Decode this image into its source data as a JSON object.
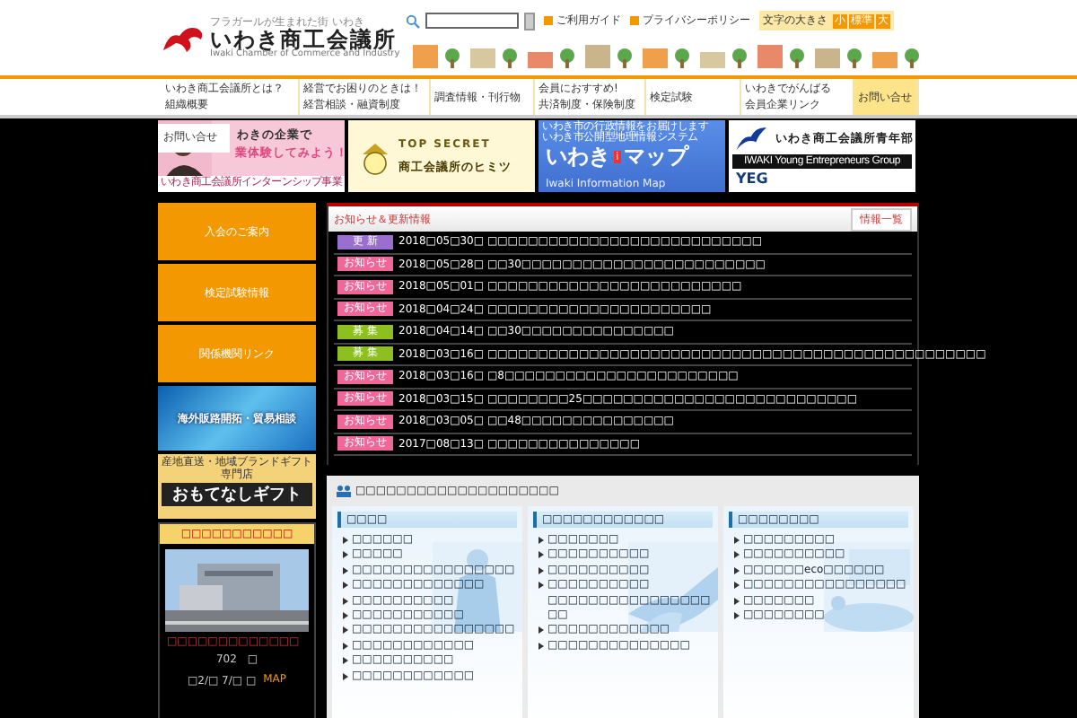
{
  "header": {
    "tagline": "フラガールが生まれた街 いわき",
    "logo_title": "いわき商工会議所",
    "logo_subtitle": "Iwaki Chamber of Commerce and Industry",
    "links": [
      "ご利用ガイド",
      "プライバシーポリシー"
    ],
    "font_size": {
      "label": "文字の大きさ",
      "options": [
        "小",
        "標準",
        "大"
      ]
    }
  },
  "nav": [
    {
      "lines": [
        "いわき商工会議所とは？",
        "組織概要"
      ],
      "selected": false
    },
    {
      "lines": [
        "経営でお困りのときは！",
        "経営相談・融資制度"
      ],
      "selected": false
    },
    {
      "lines": [
        "調査情報・刊行物"
      ],
      "selected": false
    },
    {
      "lines": [
        "会員におすすめ!",
        "共済制度・保険制度"
      ],
      "selected": false
    },
    {
      "lines": [
        "検定試験"
      ],
      "selected": false
    },
    {
      "lines": [
        "いわきでがんばる",
        "会員企業リンク"
      ],
      "selected": false
    },
    {
      "lines": [
        "お問い合せ"
      ],
      "selected": true
    }
  ],
  "tooltip": "お問い合せ",
  "banners": {
    "internship": {
      "line1": "わきの企業で",
      "line2": "業体験してみよう！",
      "footer": "いわき商工会議所インターンシップ事業"
    },
    "secret": {
      "line1": "TOP SECRET",
      "line2": "商工会議所のヒミツ"
    },
    "map": {
      "line1": "いわき市の行政情報をお届けします",
      "line2": "いわき市公開型地理情報システム",
      "word1": "いわき",
      "mark": "i",
      "word2": "マップ",
      "footer": "Iwaki Information Map"
    },
    "yeg": {
      "logo": "YEG",
      "title": "いわき商工会議所青年部",
      "subtitle": "IWAKI Young Entrepreneurs Group"
    }
  },
  "sidebar": {
    "buttons": [
      "入会のご案内",
      "検定試験情報",
      "関係機関リンク"
    ],
    "overseas_banner": "海外販路開拓・貿易相談",
    "gift_banner": {
      "tagline": "産地直送・地域ブランドギフト専門店",
      "title": "おもてなしギフト"
    },
    "notice": {
      "heading": "□□□□□□□□□□□",
      "lines": [
        "□□□□□□□□□□□□□",
        "702　□",
        "□2/□ 7/□ □"
      ],
      "link": "MAP"
    }
  },
  "news": {
    "title": "お知らせ＆更新情報",
    "more_button": "情報一覧",
    "items": [
      {
        "tag": "更 新",
        "color": "#9b6fd0",
        "text": "2018□05□30□ □□□□□□□□□□□□□□□□□□□□□□□□□□□"
      },
      {
        "tag": "お知らせ",
        "color": "#f0679a",
        "text": "2018□05□28□ □□30□□□□□□□□□□□□□□□□□□□□□□□□"
      },
      {
        "tag": "お知らせ",
        "color": "#f0679a",
        "text": "2018□05□01□ □□□□□□□□□□□□□□□□□□□□□□□□□"
      },
      {
        "tag": "お知らせ",
        "color": "#f0679a",
        "text": "2018□04□24□ □□□□□□□□□□□□□□□□□□□□□□"
      },
      {
        "tag": "募 集",
        "color": "#8cbf1f",
        "text": "2018□04□14□ □□30□□□□□□□□□□□□□□□"
      },
      {
        "tag": "募 集",
        "color": "#8cbf1f",
        "text": "2018□03□16□ □□□□□□□□□□□□□□□□□□□□□□□□□□□□□□□□□□□□□□□□□□□□□□□□□"
      },
      {
        "tag": "お知らせ",
        "color": "#f0679a",
        "text": "2018□03□16□ □8□□□□□□□□□□□□□□□□□□□□□□□"
      },
      {
        "tag": "お知らせ",
        "color": "#f0679a",
        "text": "2018□03□15□ □□□□□□□□25□□□□□□□□□□□□□□□□□□□□□□□□□□□"
      },
      {
        "tag": "お知らせ",
        "color": "#f0679a",
        "text": "2018□03□05□ □□48□□□□□□□□□□□□□□□"
      },
      {
        "tag": "お知らせ",
        "color": "#f0679a",
        "text": "2017□08□13□ □□□□□□□□□□□□□□□"
      }
    ]
  },
  "services": {
    "title": "□□□□□□□□□□□□□□□□□□□□",
    "columns": [
      {
        "heading": "□□□□",
        "items": [
          "□□□□□□",
          "□□□□□",
          "□□□□□□□□□□□□□□□□",
          "□□□□□□□□□□□□□",
          "□□□□□□□□□□",
          "□□□□□□□□□□□",
          "□□□□□□□□□□□□□□□□",
          "□□□□□□□□□□□□",
          "□□□□□□□□□□",
          "□□□□□□□□□□□□"
        ]
      },
      {
        "heading": "□□□□□□□□□□□□",
        "items": [
          "□□□□□□□",
          "□□□□□□□□□□",
          "□□□□□□□□□□",
          "□□□□□□□□□□\n□□□□□□□□□□□□□□□□□□",
          "□□□□□□□□□□□□",
          "□□□□□□□□□□□□□□"
        ]
      },
      {
        "heading": "□□□□□□□□",
        "items": [
          "□□□□□□□□□",
          "□□□□□□□□□□",
          "□□□□□□eco□□□□□□",
          "□□□□□□□□□□□□□□□□",
          "□□□□□□□",
          "□□□□□□□□"
        ]
      }
    ]
  }
}
